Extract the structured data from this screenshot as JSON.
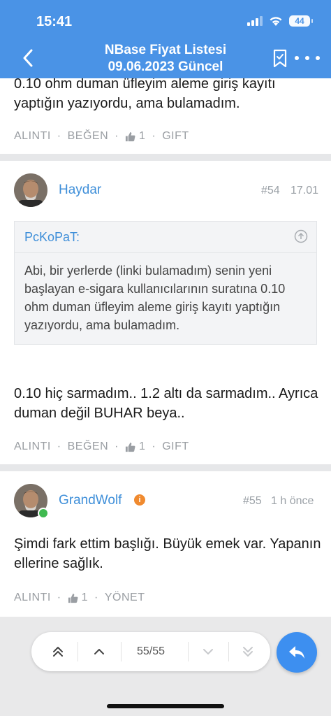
{
  "status": {
    "time": "15:41",
    "battery": "44"
  },
  "header": {
    "title_line1": "NBase Fiyat Listesi",
    "title_line2": "09.06.2023 Güncel"
  },
  "posts": [
    {
      "text": "0.10 ohm duman üfleyim aleme giriş kayıtı yaptığın yazıyordu, ama bulamadım.",
      "actions": {
        "quote": "ALINTI",
        "like": "BEĞEN",
        "like_count": "1",
        "gift": "GIFT"
      }
    },
    {
      "author": "Haydar",
      "number": "#54",
      "time": "17.01",
      "quote": {
        "author": "PcKoPaT:",
        "text": "Abi, bir yerlerde (linki bulamadım) senin yeni başlayan e-sigara kullanıcılarının suratına 0.10 ohm duman üfleyim aleme giriş kayıtı yaptığın yazıyordu, ama bulamadım."
      },
      "text": "0.10 hiç sarmadım.. 1.2 altı da sarmadım.. Ayrıca duman değil BUHAR beya..",
      "actions": {
        "quote": "ALINTI",
        "like": "BEĞEN",
        "like_count": "1",
        "gift": "GIFT"
      }
    },
    {
      "author": "GrandWolf",
      "number": "#55",
      "time": "1 h önce",
      "text": "Şimdi fark ettim başlığı. Büyük emek var. Yapanın ellerine sağlık.",
      "actions": {
        "quote": "ALINTI",
        "like_count": "1",
        "manage": "YÖNET"
      }
    }
  ],
  "pager": {
    "label": "55/55"
  },
  "colors": {
    "header": "#4a93e6",
    "accent": "#3f8fd9",
    "fab": "#3d8ff0",
    "badge": "#f08a2f"
  }
}
